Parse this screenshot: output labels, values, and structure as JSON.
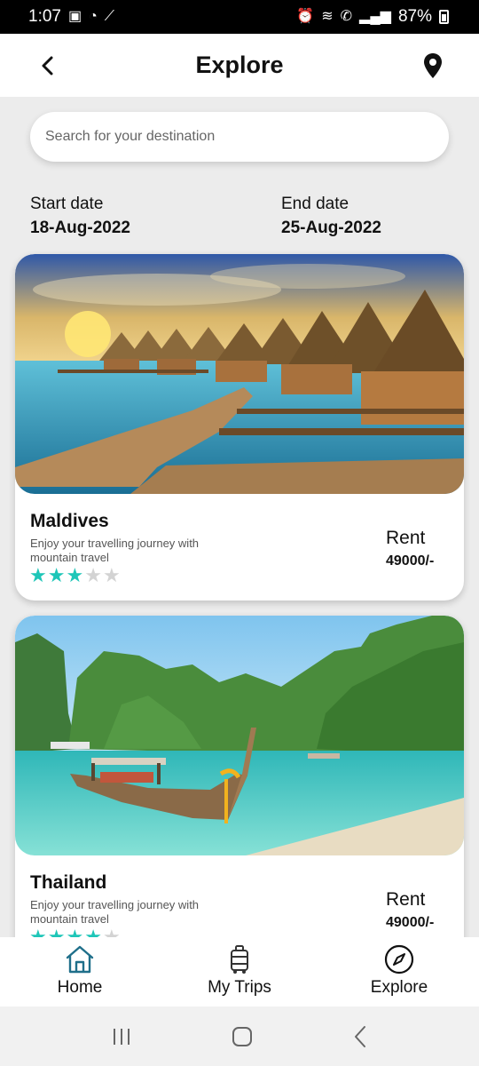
{
  "status_bar": {
    "time": "1:07",
    "battery": "87%"
  },
  "header": {
    "title": "Explore"
  },
  "search": {
    "placeholder": "Search for your destination"
  },
  "dates": {
    "start_label": "Start date",
    "start_value": "18-Aug-2022",
    "end_label": "End date",
    "end_value": "25-Aug-2022"
  },
  "cards": [
    {
      "name": "Maldives",
      "description": "Enjoy your travelling journey with mountain travel",
      "rating": 3,
      "rent_label": "Rent",
      "price": "49000/-"
    },
    {
      "name": "Thailand",
      "description": "Enjoy your travelling journey with mountain travel",
      "rating": 4,
      "rent_label": "Rent",
      "price": "49000/-"
    }
  ],
  "bottom_nav": [
    {
      "label": "Home",
      "icon": "home-icon"
    },
    {
      "label": "My Trips",
      "icon": "luggage-icon"
    },
    {
      "label": "Explore",
      "icon": "compass-icon"
    }
  ],
  "colors": {
    "accent": "#1ec6b8",
    "home_icon": "#1f6f8a"
  }
}
